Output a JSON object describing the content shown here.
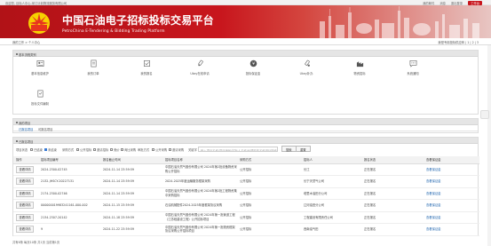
{
  "topbar": {
    "left_text": "欢迎您, 目标人中心-采订计划物流服务有限公司",
    "right_items": [
      "我的邮件",
      "消息",
      "退出登录"
    ],
    "workbench_label": "工作台"
  },
  "banner": {
    "title": "中国石油电子招标投标交易平台",
    "subtitle": "PetroChina E-Tendering & Bidding Trading Platform"
  },
  "navbar": {
    "breadcrumb": "我的工作 > 个人中心",
    "right_text": "我是专用投标供应商 | 1 | 2 | 3"
  },
  "common_funcs": {
    "title": "基本流程类别",
    "items": [
      {
        "label": "基本信息维护",
        "icon": "profile-card-icon"
      },
      {
        "label": "我的订单",
        "icon": "order-icon"
      },
      {
        "label": "我的报名",
        "icon": "signup-icon"
      },
      {
        "label": "Ukey在线申请",
        "icon": "ukey-icon"
      },
      {
        "label": "投标保证金",
        "icon": "deposit-icon"
      },
      {
        "label": "Ukey补办",
        "icon": "ukey-reissue-icon"
      },
      {
        "label": "物资招标",
        "icon": "material-icon"
      },
      {
        "label": "系统通知",
        "icon": "message-icon"
      },
      {
        "label": "投标文件编制",
        "icon": "bid-doc-icon"
      }
    ]
  },
  "project_panel": {
    "title": "我的项目",
    "tabs": [
      "已报名项目",
      "可报名项目"
    ]
  },
  "bid_panel": {
    "title": "已报名项目",
    "filters": {
      "label_status": "项目状态",
      "status_opts": [
        "已结束",
        "未结束"
      ],
      "label_method": "采购方式",
      "method_opts": [
        "公开招标",
        "邀请招标",
        "竞价",
        "询比采购"
      ],
      "label_scope": "审批方式",
      "scope_opts": [
        "公开采购",
        "邀请采购"
      ],
      "label_keyword": "关键字",
      "search_placeholder": "输入项目名称/项目编号/招标人名称/代理机构名称进行搜索",
      "search_button": "搜索",
      "reset_button": "重置"
    },
    "columns": [
      "操作",
      "招标项目编号",
      "报名截止时间",
      "招标项目名称",
      "采购方式",
      "招标人",
      "报名状态",
      "查看保证金"
    ],
    "rows": [
      {
        "op": "查看详情",
        "code": "2024-2300-02745",
        "time": "2024-11-14 23:59:59",
        "name": "中国石油天然气股份有限公司 2024年第2批设备物资采购公开招标",
        "method": "公开招标",
        "tenderer": "长江",
        "status": "正在报名",
        "deposit": "查看保证金"
      },
      {
        "op": "查看详情",
        "code": "2132-JHSCY-20227131",
        "time": "2024-11-14 23:59:59",
        "name": "2024-2025年度运输服务框架采购",
        "method": "公开招标",
        "tenderer": "长宁天然气公司",
        "status": "正在报名",
        "deposit": "查看保证金"
      },
      {
        "op": "查看详情",
        "code": "2174-2300-02746",
        "time": "2024-11-14 23:59:59",
        "name": "中国石油天然气股份有限公司 2024年第2批工程物资集中采购招标",
        "method": "公开招标",
        "tenderer": "塔里木油田分公司",
        "status": "正在报名",
        "deposit": "查看保证金"
      },
      {
        "op": "查看详情",
        "code": "000000019983241161-000-002",
        "time": "2024-11-15 23:59:59",
        "name": "石油机械配件2024-2025年度框架协议采购",
        "method": "公开招标",
        "tenderer": "辽河油田分公司",
        "status": "正在报名",
        "deposit": "查看保证金"
      },
      {
        "op": "查看详情",
        "code": "2134-2307-20142",
        "time": "2024-11-18 23:59:59",
        "name": "中国石油天然气股份有限公司 2024年第一批管道工程（江苏段建设工程）公开招标项目",
        "method": "公开招标",
        "tenderer": "工程建设有限责任公司",
        "status": "正在报名",
        "deposit": "查看保证金"
      },
      {
        "op": "查看详情",
        "code": "9",
        "time": "2024-11-22 23:59:59",
        "name": "中国石油天然气股份有限公司 2024年第一批物资框架协议采购公开招标项目",
        "method": "公开招标",
        "tenderer": "西南油气田",
        "status": "正在报名",
        "deposit": "查看保证金"
      }
    ]
  },
  "footer": {
    "text": "共有6条 每页10条 共1页 当前第1页"
  }
}
